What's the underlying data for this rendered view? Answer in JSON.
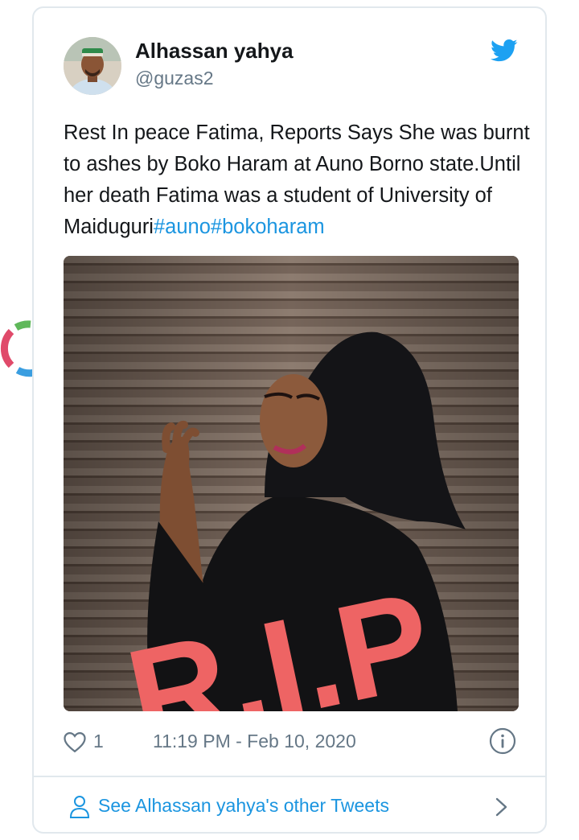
{
  "tweet": {
    "author": {
      "name": "Alhassan yahya",
      "handle": "@guzas2"
    },
    "text_plain": "Rest In peace Fatima, Reports Says  She was burnt to ashes by Boko Haram at Auno Borno state.Until her death Fatima was a student of University of Maiduguri",
    "hashtags": [
      "#auno",
      "#bokoharam"
    ],
    "image_caption_overlay": "R.I.P",
    "likes": "1",
    "timestamp": "11:19 PM - Feb 10, 2020"
  },
  "footer": {
    "other_tweets_label": "See Alhassan yahya's other Tweets"
  },
  "colors": {
    "link": "#1b95e0",
    "secondary_text": "#657786",
    "border": "#e1e8ed",
    "twitter_blue": "#1da1f2",
    "rip_overlay": "#f26a6a"
  },
  "icons": [
    "twitter-bird-icon",
    "heart-icon",
    "info-icon",
    "user-icon",
    "chevron-right-icon",
    "loading-spinner-icon"
  ]
}
